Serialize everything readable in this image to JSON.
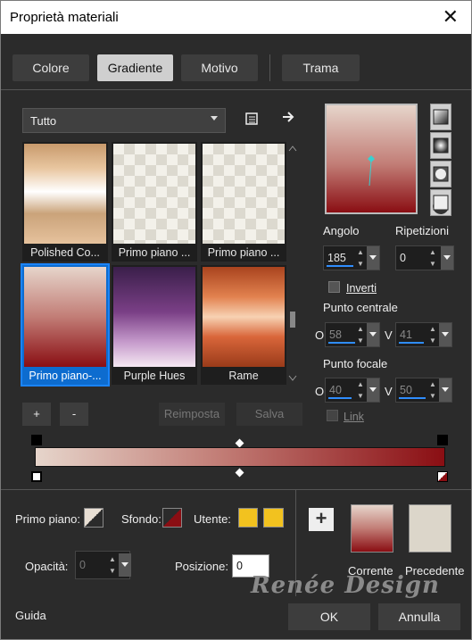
{
  "window": {
    "title": "Proprietà materiali",
    "close_glyph": "✕"
  },
  "tabs": [
    {
      "label": "Colore"
    },
    {
      "label": "Gradiente"
    },
    {
      "label": "Motivo"
    },
    {
      "label": "Trama"
    }
  ],
  "library": {
    "category": "Tutto",
    "items": [
      {
        "label": "Polished Co..."
      },
      {
        "label": "Primo piano ..."
      },
      {
        "label": "Primo piano ..."
      },
      {
        "label": "Primo piano-..."
      },
      {
        "label": "Purple Hues"
      },
      {
        "label": "Rame"
      }
    ],
    "buttons": {
      "add": "+",
      "remove": "-",
      "reset": "Reimposta",
      "save": "Salva"
    }
  },
  "settings": {
    "angle_label": "Angolo",
    "angle_value": "185",
    "repeat_label": "Ripetizioni",
    "repeat_value": "0",
    "invert_label": "Inverti",
    "center_label": "Punto centrale",
    "center_o": "58",
    "center_v": "41",
    "focal_label": "Punto focale",
    "focal_o": "40",
    "focal_v": "50",
    "link_label": "Link",
    "o_label": "O",
    "v_label": "V"
  },
  "bottom": {
    "fg_label": "Primo piano:",
    "bg_label": "Sfondo:",
    "user_label": "Utente:",
    "opacity_label": "Opacità:",
    "opacity_value": "0",
    "position_label": "Posizione:",
    "position_value": "0",
    "current_label": "Corrente",
    "previous_label": "Precedente",
    "plus_glyph": "+"
  },
  "footer": {
    "help": "Guida",
    "ok": "OK",
    "cancel": "Annulla"
  },
  "watermark": "Renée Design",
  "colors": {
    "accent": "#0d6ccf",
    "gradient_start": "#e6d5cb",
    "gradient_end": "#8a0e13",
    "user_swatch": "#f2c21f"
  }
}
